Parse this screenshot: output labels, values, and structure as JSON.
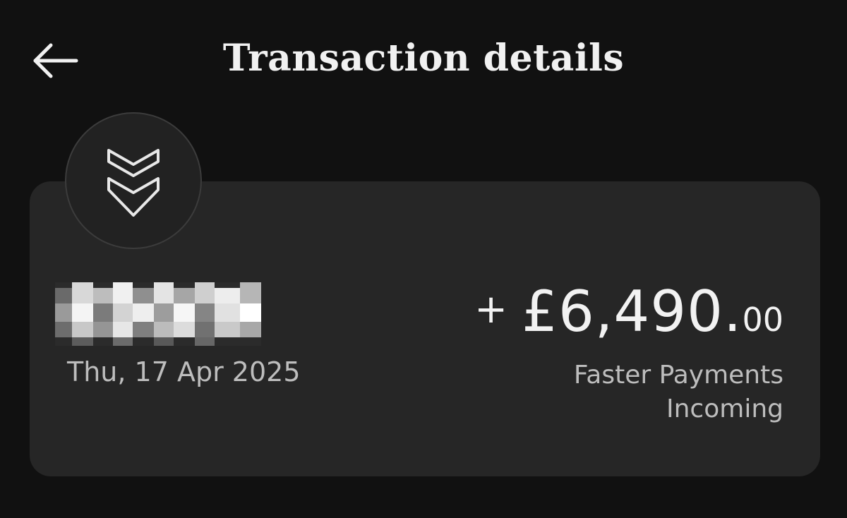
{
  "header": {
    "title": "Transaction details",
    "back_icon": "arrow-left-icon"
  },
  "transaction": {
    "merchant_logo_icon": "double-chevron-down-icon",
    "merchant_name": "",
    "date": "Thu, 17 Apr 2025",
    "amount_sign": "+",
    "amount_main": "£6,490.",
    "amount_decimal": "00",
    "payment_type_line1": "Faster Payments",
    "payment_type_line2": "Incoming"
  },
  "colors": {
    "background": "#111111",
    "card": "#262626",
    "text_primary": "#f1f1f1",
    "text_secondary": "#bdbdbd"
  }
}
